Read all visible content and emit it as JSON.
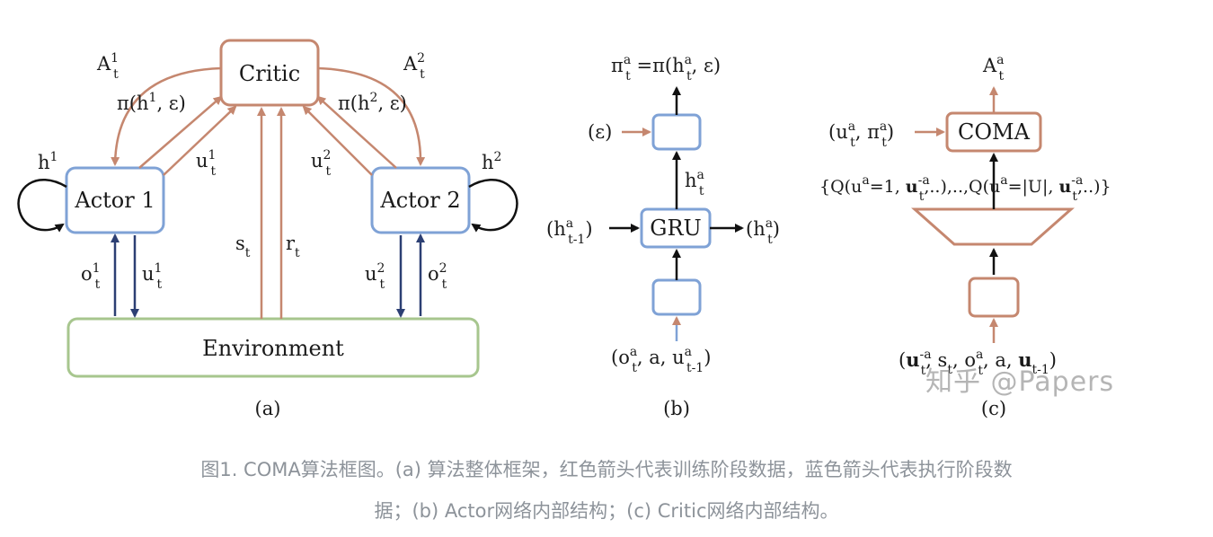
{
  "colors": {
    "red": "#c5876f",
    "blue": "#7fa2d6",
    "green": "#a7c68e",
    "dark_blue": "#2c3f73",
    "black": "#111111"
  },
  "panel_a": {
    "critic": "Critic",
    "actor1": "Actor 1",
    "actor2": "Actor 2",
    "environment": "Environment",
    "label": "(a)"
  },
  "panel_b": {
    "gru": "GRU",
    "label": "(b)"
  },
  "panel_c": {
    "coma": "COMA",
    "label": "(c)"
  },
  "caption": {
    "line1": "图1. COMA算法框图。(a) 算法整体框架，红色箭头代表训练阶段数据，蓝色箭头代表执行阶段数",
    "line2": "据；(b) Actor网络内部结构；(c) Critic网络内部结构。"
  },
  "watermark": "知乎 @Papers"
}
